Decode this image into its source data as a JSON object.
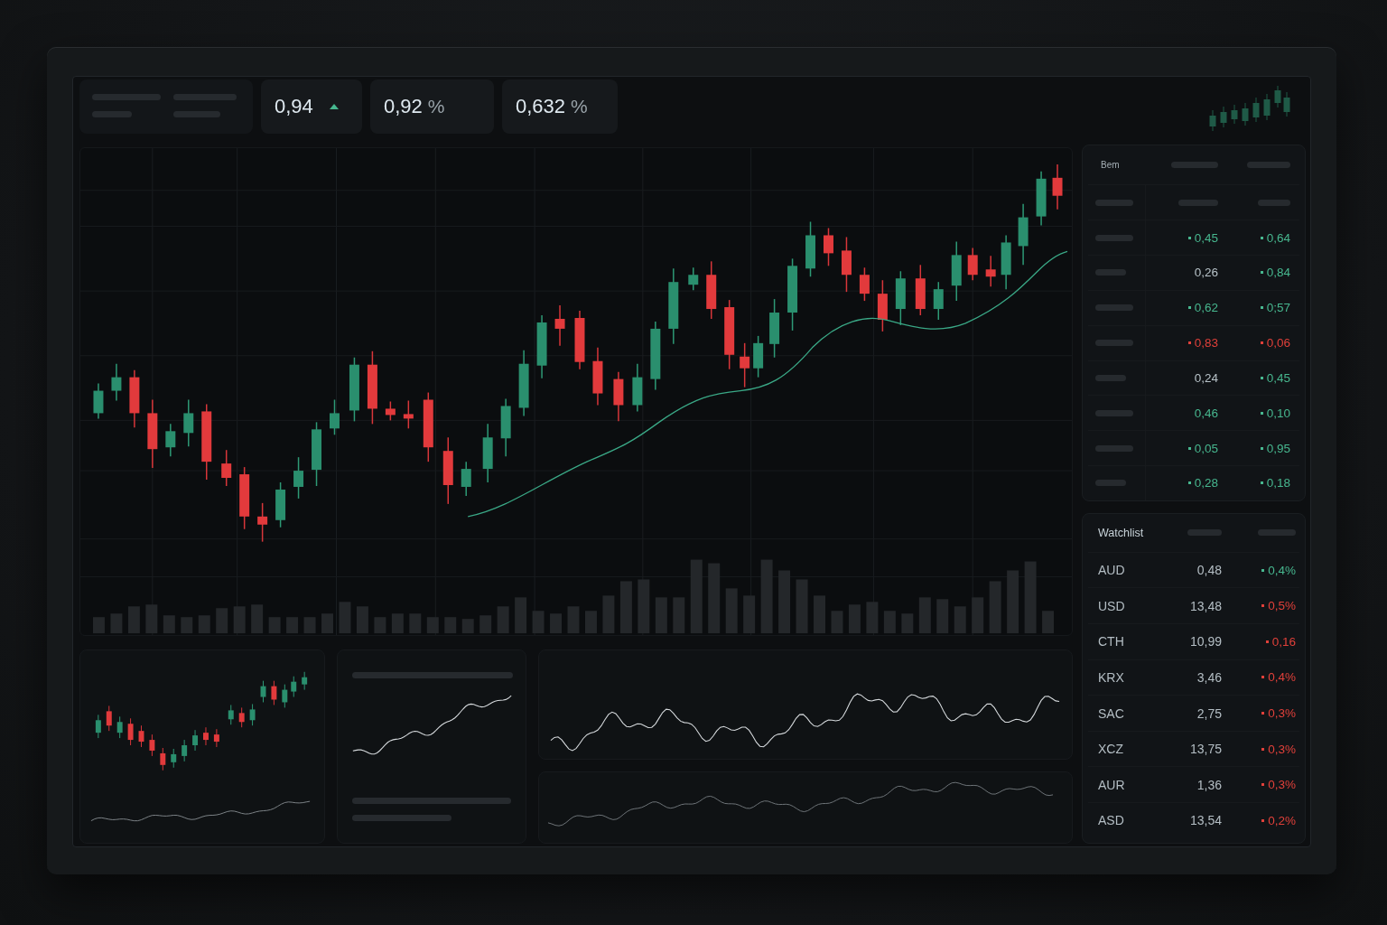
{
  "stats": [
    {
      "value": "0,94",
      "arrow_up": true
    },
    {
      "value": "0,92",
      "unit": "%",
      "arrow_up": false
    },
    {
      "value": "0,632",
      "unit": "%",
      "arrow_up": false
    }
  ],
  "market_table": {
    "header": "Bem",
    "rows": [
      {
        "column_2": {
          "value": "0,45",
          "color": "#47b78f",
          "dot": true
        },
        "column_3": {
          "value": "0,64",
          "color": "#47b78f",
          "dot": true
        }
      },
      {
        "column_2": {
          "value": "0,26",
          "color": "#b7c2c8",
          "dot": false
        },
        "column_3": {
          "value": "0,84",
          "color": "#47b78f",
          "dot": true
        }
      },
      {
        "column_2": {
          "value": "0,62",
          "color": "#47b78f",
          "dot": true
        },
        "column_3": {
          "value": "0;57",
          "color": "#47b78f",
          "dot": true
        }
      },
      {
        "column_2": {
          "value": "0,83",
          "color": "#e0403a",
          "dot": true
        },
        "column_3": {
          "value": "0,06",
          "color": "#e0403a",
          "dot": true
        }
      },
      {
        "column_2": {
          "value": "0,24",
          "color": "#b7c2c8",
          "dot": false
        },
        "column_3": {
          "value": "0,45",
          "color": "#47b78f",
          "dot": true
        }
      },
      {
        "column_2": {
          "value": "0,46",
          "color": "#47b78f",
          "dot": false
        },
        "column_3": {
          "value": "0,10",
          "color": "#47b78f",
          "dot": true
        }
      },
      {
        "column_2": {
          "value": "0,05",
          "color": "#47b78f",
          "dot": true
        },
        "column_3": {
          "value": "0,95",
          "color": "#47b78f",
          "dot": true
        }
      },
      {
        "column_2": {
          "value": "0,28",
          "color": "#47b78f",
          "dot": true
        },
        "column_3": {
          "value": "0,18",
          "color": "#47b78f",
          "dot": true
        }
      }
    ]
  },
  "watchlist": {
    "title": "Watchlist",
    "rows": [
      {
        "symbol": "AUD",
        "price": "0,48",
        "change": "0,4%",
        "color": "#47b78f"
      },
      {
        "symbol": "USD",
        "price": "13,48",
        "change": "0,5%",
        "color": "#e0403a"
      },
      {
        "symbol": "CTH",
        "price": "10,99",
        "change": "0,16",
        "color": "#e0403a"
      },
      {
        "symbol": "KRX",
        "price": "3,46",
        "change": "0,4%",
        "color": "#e0403a"
      },
      {
        "symbol": "SAC",
        "price": "2,75",
        "change": "0,3%",
        "color": "#e0403a"
      },
      {
        "symbol": "XCZ",
        "price": "13,75",
        "change": "0,3%",
        "color": "#e0403a"
      },
      {
        "symbol": "AUR",
        "price": "1,36",
        "change": "0,3%",
        "color": "#e0403a"
      },
      {
        "symbol": "ASD",
        "price": "13,54",
        "change": "0,2%",
        "color": "#e0403a"
      }
    ]
  }
}
